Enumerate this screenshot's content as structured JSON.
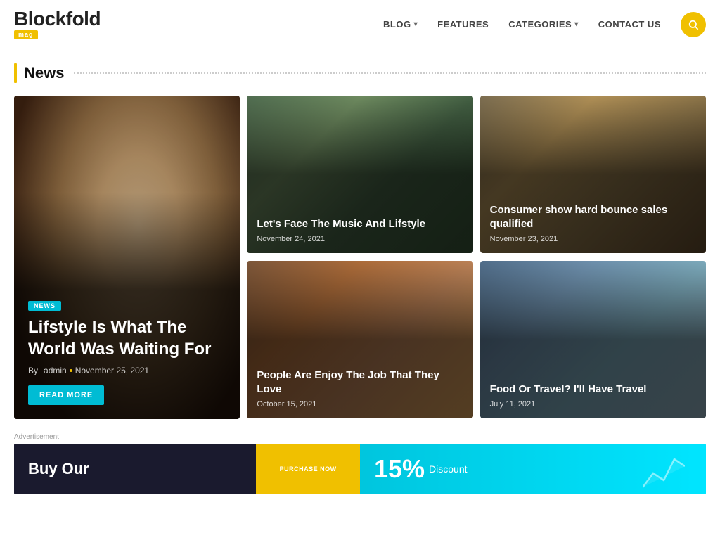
{
  "header": {
    "logo_text": "Blockfold",
    "logo_badge": "mag",
    "nav": [
      {
        "id": "blog",
        "label": "BLOG",
        "has_dropdown": true
      },
      {
        "id": "features",
        "label": "FEATURES",
        "has_dropdown": false
      },
      {
        "id": "categories",
        "label": "CATEGORIES",
        "has_dropdown": true
      },
      {
        "id": "contact",
        "label": "CONTACT US",
        "has_dropdown": false
      }
    ],
    "search_aria": "Search"
  },
  "section": {
    "title": "News",
    "dots_aria": "section-divider"
  },
  "news": {
    "main": {
      "tag": "NEWS",
      "title": "Lifstyle Is What The World Was Waiting For",
      "author": "admin",
      "date": "November 25, 2021",
      "read_more": "READ MORE"
    },
    "cards": [
      {
        "id": "card1",
        "title": "Let's Face The Music And Lifstyle",
        "date": "November 24, 2021",
        "bg_class": "card1-bg"
      },
      {
        "id": "card2",
        "title": "Consumer show hard bounce sales qualified",
        "date": "November 23, 2021",
        "bg_class": "card2-bg"
      },
      {
        "id": "card3",
        "title": "People Are Enjoy The Job That They Love",
        "date": "October 15, 2021",
        "bg_class": "card3-bg"
      },
      {
        "id": "card4",
        "title": "Food Or Travel? I'll Have Travel",
        "date": "July 11, 2021",
        "bg_class": "card4-bg"
      }
    ]
  },
  "ad": {
    "label": "Advertisement",
    "buy_text": "Buy Our",
    "purchase_btn": "PURCHASE NOW",
    "discount": "15%",
    "off_text": "Discount"
  },
  "icons": {
    "search": "🔍",
    "chevron_down": "▾"
  }
}
